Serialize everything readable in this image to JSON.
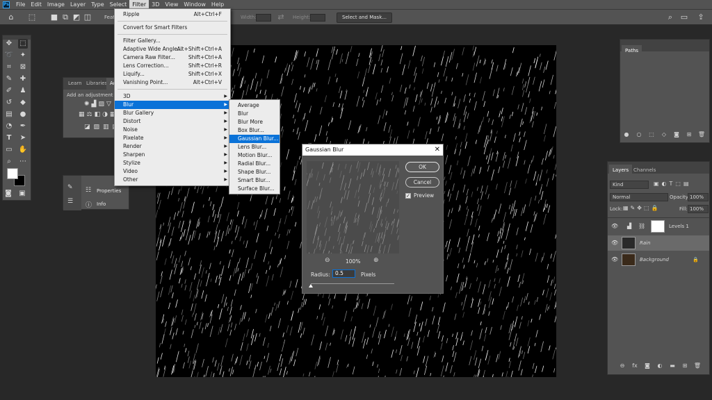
{
  "menubar": {
    "logo": "Ps",
    "items": [
      "File",
      "Edit",
      "Image",
      "Layer",
      "Type",
      "Select",
      "Filter",
      "3D",
      "View",
      "Window",
      "Help"
    ],
    "active": "Filter"
  },
  "options_bar": {
    "feather_label": "Feat",
    "width_label": "Width:",
    "height_label": "Height:",
    "select_mask": "Select and Mask..."
  },
  "filter_menu": {
    "items": [
      {
        "label": "Ripple",
        "shortcut": "Alt+Ctrl+F"
      },
      {
        "label": "Convert for Smart Filters",
        "shortcut": ""
      },
      {
        "label": "Filter Gallery...",
        "shortcut": ""
      },
      {
        "label": "Adaptive Wide Angle...",
        "shortcut": "Alt+Shift+Ctrl+A"
      },
      {
        "label": "Camera Raw Filter...",
        "shortcut": "Shift+Ctrl+A"
      },
      {
        "label": "Lens Correction...",
        "shortcut": "Shift+Ctrl+R"
      },
      {
        "label": "Liquify...",
        "shortcut": "Shift+Ctrl+X"
      },
      {
        "label": "Vanishing Point...",
        "shortcut": "Alt+Ctrl+V"
      },
      {
        "label": "3D",
        "shortcut": ""
      },
      {
        "label": "Blur",
        "shortcut": ""
      },
      {
        "label": "Blur Gallery",
        "shortcut": ""
      },
      {
        "label": "Distort",
        "shortcut": ""
      },
      {
        "label": "Noise",
        "shortcut": ""
      },
      {
        "label": "Pixelate",
        "shortcut": ""
      },
      {
        "label": "Render",
        "shortcut": ""
      },
      {
        "label": "Sharpen",
        "shortcut": ""
      },
      {
        "label": "Stylize",
        "shortcut": ""
      },
      {
        "label": "Video",
        "shortcut": ""
      },
      {
        "label": "Other",
        "shortcut": ""
      }
    ],
    "highlighted": "Blur"
  },
  "blur_submenu": {
    "items": [
      "Average",
      "Blur",
      "Blur More",
      "Box Blur...",
      "Gaussian Blur...",
      "Lens Blur...",
      "Motion Blur...",
      "Radial Blur...",
      "Shape Blur...",
      "Smart Blur...",
      "Surface Blur..."
    ],
    "highlighted": "Gaussian Blur..."
  },
  "adjustments_panel": {
    "tabs": [
      "Learn",
      "Libraries",
      "Ad"
    ],
    "hint": "Add an adjustment"
  },
  "props_panel": {
    "properties": "Properties",
    "info": "Info"
  },
  "gaussian_dialog": {
    "title": "Gaussian Blur",
    "ok": "OK",
    "cancel": "Cancel",
    "preview_label": "Preview",
    "preview_checked": true,
    "zoom": "100%",
    "radius_label": "Radius:",
    "radius_value": "0.5",
    "radius_unit": "Pixels"
  },
  "paths_panel": {
    "tab": "Paths"
  },
  "layers_panel": {
    "tabs": [
      "Layers",
      "Channels"
    ],
    "filter": "Kind",
    "blend_mode": "Normal",
    "opacity_label": "Opacity:",
    "opacity": "100%",
    "lock_label": "Lock:",
    "fill_label": "Fill:",
    "fill": "100%",
    "layers": [
      {
        "name": "Levels 1"
      },
      {
        "name": "Rain"
      },
      {
        "name": "Background"
      }
    ]
  },
  "colors": {
    "menu_highlight": "#0a72d8",
    "ui": "#535353"
  }
}
